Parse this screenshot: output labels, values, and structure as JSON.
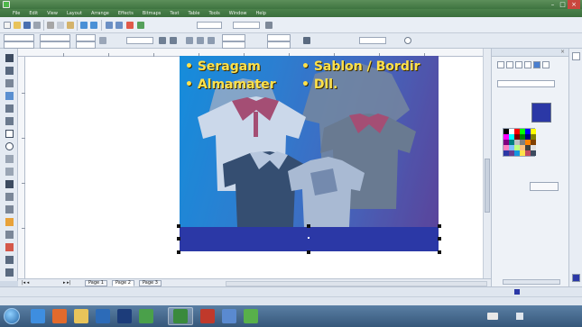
{
  "window": {
    "title": "",
    "controls": [
      "minimize",
      "maximize",
      "close"
    ]
  },
  "menu": {
    "items": [
      "File",
      "Edit",
      "View",
      "Layout",
      "Arrange",
      "Effects",
      "Bitmaps",
      "Text",
      "Table",
      "Tools",
      "Window",
      "Help"
    ]
  },
  "toolbar": {
    "zoom_value": "",
    "snap_label": "",
    "x_field": "",
    "y_field": "",
    "w_field": "",
    "h_field": "",
    "scale_w": "",
    "scale_h": "",
    "angle_value": "",
    "outline_width": "",
    "outline_style": ""
  },
  "artwork": {
    "bullet_1": "• Seragam",
    "bullet_2": "• Sablon / Bordir",
    "bullet_3": "• Almamater",
    "bullet_4": "• Dll.",
    "background_color": "#2e86d4",
    "footer_band_color": "#2b38a6",
    "text_color": "#ffe14a",
    "shirt_colors": [
      "#f2f2f2",
      "#7b7f86",
      "#c24a62",
      "#3b4a5e",
      "#c8cdd6"
    ]
  },
  "pages": {
    "position": "",
    "tabs": [
      "Page 1",
      "Page 2",
      "Page 3"
    ],
    "active_index": 1
  },
  "status": {
    "coordinates": "",
    "selection_info": "",
    "document_profile": "",
    "fill_info": "",
    "outline_info": ""
  },
  "docker": {
    "title": "",
    "fill_type_label": "",
    "fill_type_value": "",
    "uniform_fill_label": "",
    "new_label": "",
    "new_color": "#2b38a6",
    "advanced_button": "",
    "swatches": [
      "#000000",
      "#ffffff",
      "#ff0000",
      "#00ff00",
      "#0000ff",
      "#ffff00",
      "#ff00ff",
      "#00ffff",
      "#800000",
      "#008000",
      "#000080",
      "#808000",
      "#800080",
      "#008080",
      "#c0c0c0",
      "#808080",
      "#ff8000",
      "#804000",
      "#ff80c0",
      "#80c0ff",
      "#c0ff80",
      "#ffc080",
      "#404040",
      "#e0e0e0",
      "#2b38a6",
      "#6a3b8f",
      "#1496e0",
      "#ffe14a",
      "#c24a62",
      "#3b4a5e"
    ]
  },
  "taskbar": {
    "time": "",
    "date": "",
    "apps": [
      "ie-icon",
      "firefox-icon",
      "explorer-icon",
      "media-icon",
      "photoshop-icon",
      "app-icon",
      "corel-icon",
      "app2-icon",
      "app3-icon",
      "app4-icon"
    ]
  }
}
